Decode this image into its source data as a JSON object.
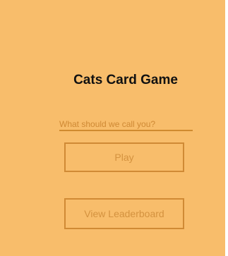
{
  "game": {
    "title": "Cats Card Game"
  },
  "name_input": {
    "value": "",
    "placeholder": "What should we call you?"
  },
  "buttons": {
    "play_label": "Play",
    "leaderboard_label": "View Leaderboard"
  },
  "colors": {
    "background": "#f8bd6b",
    "accent": "#d08a35",
    "title": "#111111"
  }
}
